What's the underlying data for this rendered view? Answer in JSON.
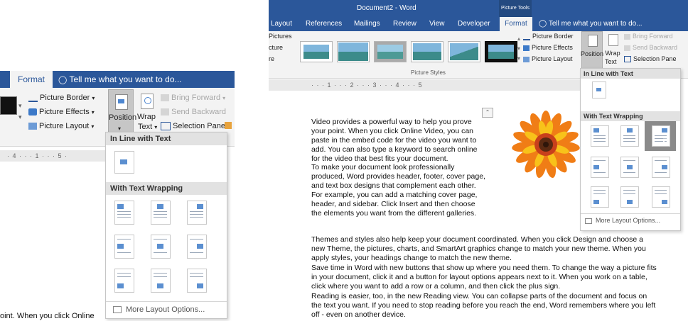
{
  "left": {
    "tabs": {
      "format": "Format",
      "tell_me": "Tell me what you want to do..."
    },
    "ribbon": {
      "picture_border": "Picture Border",
      "picture_effects": "Picture Effects",
      "picture_layout": "Picture Layout",
      "position": "Position",
      "wrap": "Wrap",
      "text": "Text",
      "bring_forward": "Bring Forward",
      "send_backward": "Send Backward",
      "selection_pane": "Selection Pane"
    },
    "ruler": "· 4 · · · 1 · · · 5 ·",
    "gallery": {
      "inline_header": "In Line with Text",
      "wrap_header": "With Text Wrapping",
      "more": "More Layout Options..."
    },
    "doc_fragment": "oint. When you click Online"
  },
  "right": {
    "title": "Document2 - Word",
    "context": "Picture Tools",
    "tabs": [
      "Layout",
      "References",
      "Mailings",
      "Review",
      "View",
      "Developer",
      "Format"
    ],
    "tell_me": "Tell me what you want to do...",
    "ribbon": {
      "left_partial": [
        "Pictures",
        "cture",
        "re"
      ],
      "styles_label": "Picture Styles",
      "picture_border": "Picture Border",
      "picture_effects": "Picture Effects",
      "picture_layout": "Picture Layout",
      "position": "Position",
      "wrap": "Wrap",
      "text": "Text",
      "bring_forward": "Bring Forward",
      "send_backward": "Send Backward",
      "selection_pane": "Selection Pane"
    },
    "ruler": "· · · 1 · · · 2 · · · 3 · · · 4 · · · 5",
    "gallery": {
      "inline_header": "In Line with Text",
      "wrap_header": "With Text Wrapping",
      "more": "More Layout Options..."
    },
    "paragraphs": [
      "Video provides a powerful way to help you prove your point. When you click Online Video, you can paste in the embed code for the video you want to add. You can also type a keyword to search online for the video that best fits your document.",
      "To make your document look professionally produced, Word provides header, footer, cover page, and text box designs that complement each other. For example, you can add a matching cover page, header, and sidebar. Click Insert and then choose the elements you want from the different galleries.",
      "Themes and styles also help keep your document coordinated. When you click Design and choose a new Theme, the pictures, charts, and SmartArt graphics change to match your new theme. When you apply styles, your headings change to match the new theme.",
      "Save time in Word with new buttons that show up where you need them. To change the way a picture fits in your document, click it and a button for layout options appears next to it. When you work on a table, click where you want to add a row or a column, and then click the plus sign.",
      "Reading is easier, too, in the new Reading view. You can collapse parts of the document and focus on the text you want. If you need to stop reading before you reach the end, Word remembers where you left off - even on another device."
    ]
  },
  "colors": {
    "ribbon_blue": "#2b579a",
    "ribbon_bg": "#f3f3f3",
    "selected_tile": "#8a8a8a"
  }
}
